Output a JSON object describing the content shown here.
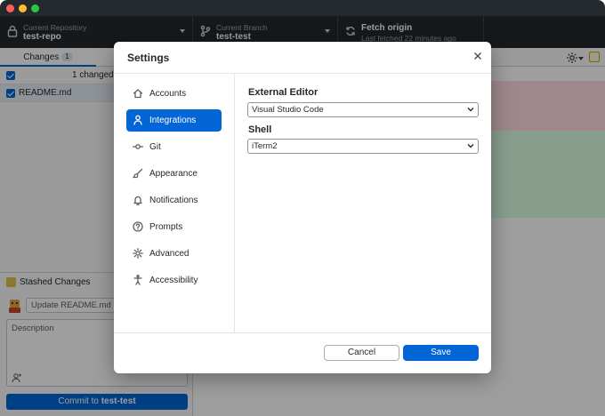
{
  "toolbar": {
    "repo_label": "Current Repository",
    "repo_value": "test-repo",
    "branch_label": "Current Branch",
    "branch_value": "test-test",
    "fetch_label": "Fetch origin",
    "fetch_sub": "Last fetched 22 minutes ago"
  },
  "changes": {
    "tab_label": "Changes",
    "tab_count": "1",
    "header": "1 changed f",
    "files": [
      "README.md"
    ]
  },
  "stash": {
    "label": "Stashed Changes"
  },
  "commit": {
    "summary_placeholder": "Update README.md",
    "description_placeholder": "Description",
    "button_prefix": "Commit to ",
    "button_branch": "test-test"
  },
  "dialog": {
    "title": "Settings",
    "nav": [
      {
        "label": "Accounts",
        "icon": "home-icon"
      },
      {
        "label": "Integrations",
        "icon": "person-icon",
        "active": true
      },
      {
        "label": "Git",
        "icon": "git-commit-icon"
      },
      {
        "label": "Appearance",
        "icon": "paintbrush-icon"
      },
      {
        "label": "Notifications",
        "icon": "bell-icon"
      },
      {
        "label": "Prompts",
        "icon": "question-icon"
      },
      {
        "label": "Advanced",
        "icon": "gear-icon"
      },
      {
        "label": "Accessibility",
        "icon": "accessibility-icon"
      }
    ],
    "editor_label": "External Editor",
    "editor_value": "Visual Studio Code",
    "shell_label": "Shell",
    "shell_value": "iTerm2",
    "cancel_label": "Cancel",
    "save_label": "Save"
  },
  "colors": {
    "accent": "#0366d6",
    "toolbar_bg": "#24292e",
    "diff_deleted": "#ffdce0",
    "diff_added": "#dcffe4"
  }
}
